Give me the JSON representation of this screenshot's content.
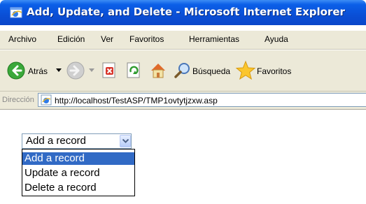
{
  "window": {
    "title": "Add, Update, and Delete - Microsoft Internet Explorer"
  },
  "menu": {
    "items": [
      "Archivo",
      "Edición",
      "Ver",
      "Favoritos",
      "Herramientas",
      "Ayuda"
    ]
  },
  "toolbar": {
    "back_label": "Atrás",
    "search_label": "Búsqueda",
    "favorites_label": "Favoritos"
  },
  "address_bar": {
    "label": "Dirección",
    "url": "http://localhost/TestASP/TMP1ovtytjzxw.asp"
  },
  "page": {
    "select": {
      "selected": "Add a record",
      "options": [
        "Add a record",
        "Update a record",
        "Delete a record"
      ],
      "highlighted_index": 0
    }
  },
  "colors": {
    "titlebar": "#0a4fd6",
    "chrome": "#ece9d8",
    "selection": "#316ac5"
  }
}
